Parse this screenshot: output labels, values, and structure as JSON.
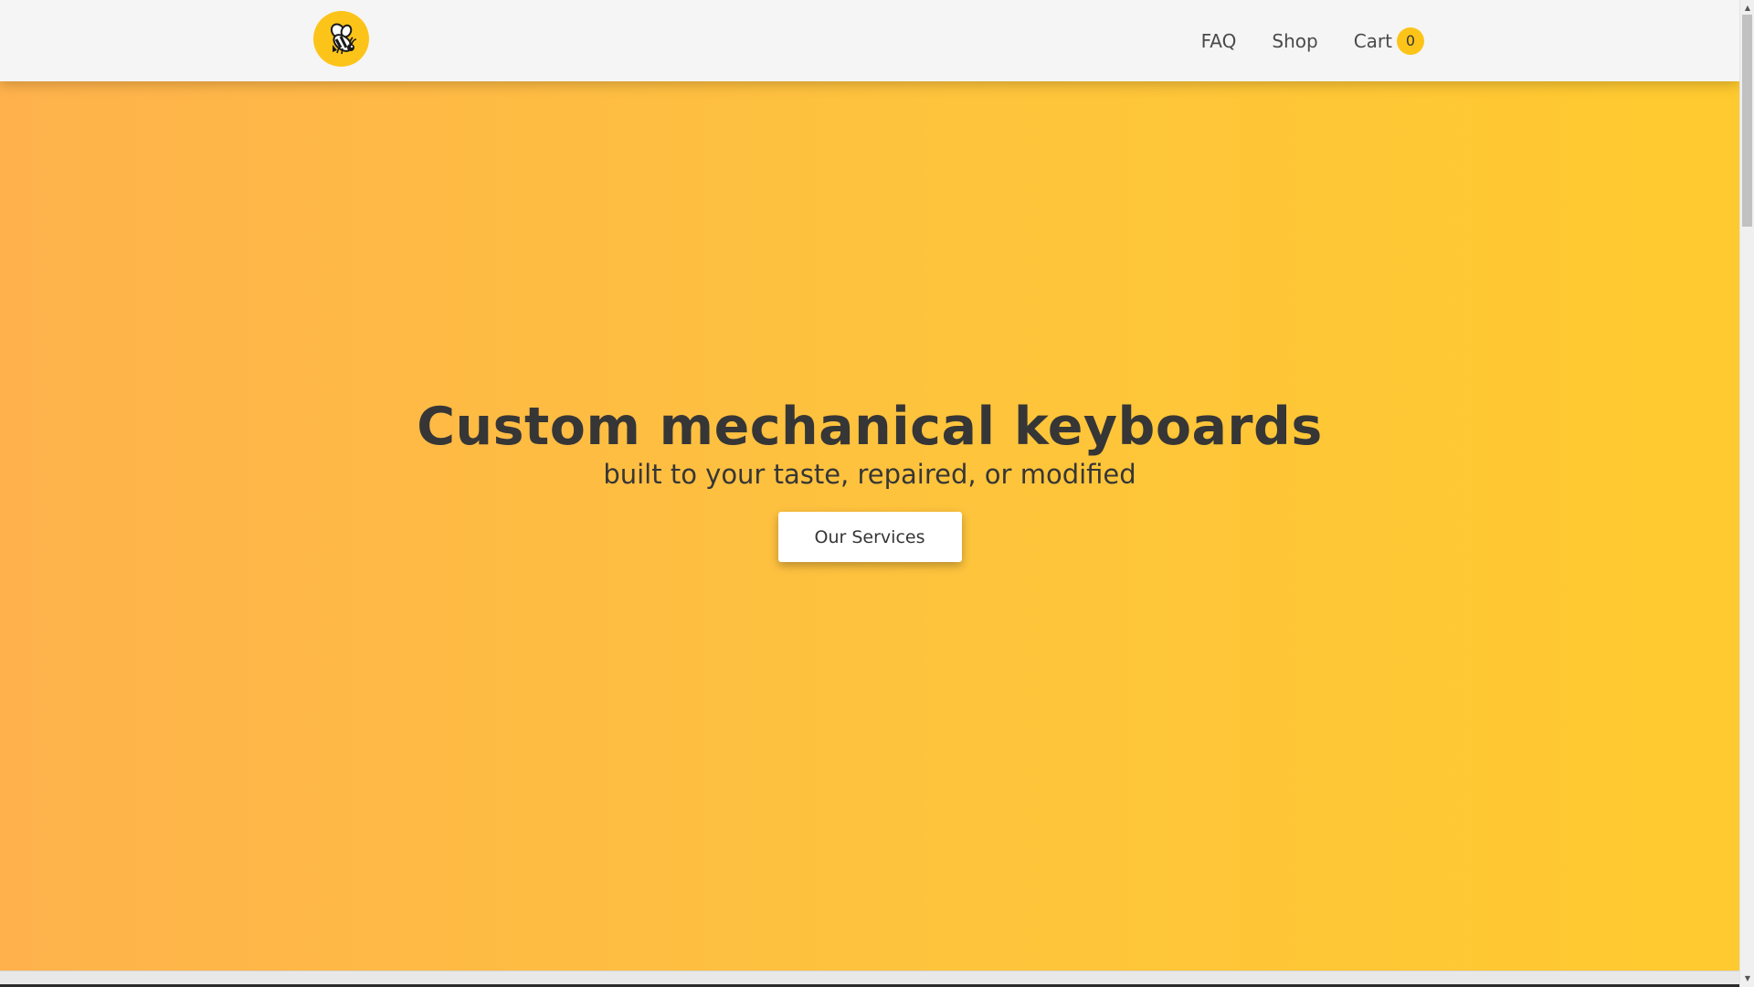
{
  "navbar": {
    "logo_icon": "bee-icon",
    "links": {
      "faq": "FAQ",
      "shop": "Shop",
      "cart": "Cart",
      "cart_count": "0"
    }
  },
  "hero": {
    "title": "Custom mechanical keyboards",
    "subtitle": "built to your taste, repaired, or modified",
    "cta_label": "Our Services"
  },
  "colors": {
    "accent": "#fcc419",
    "hero_gradient_start": "#ffb24c",
    "hero_gradient_end": "#ffca2f",
    "text": "#363636",
    "navbar_bg": "#f5f5f5"
  }
}
